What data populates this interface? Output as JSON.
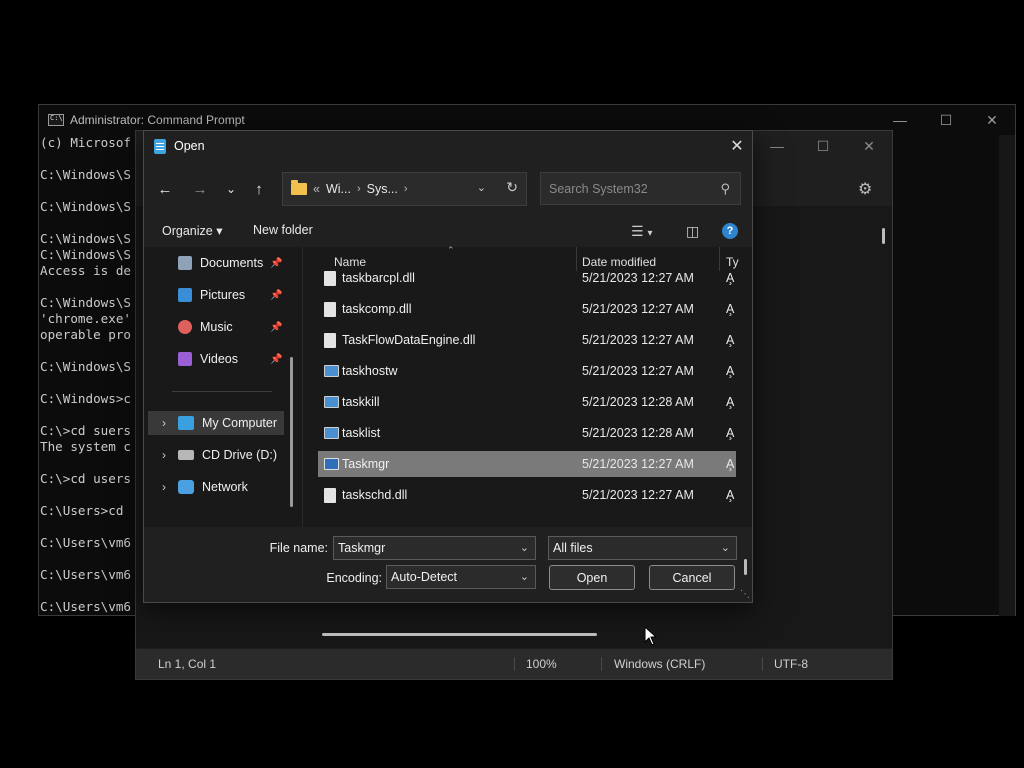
{
  "cmd": {
    "title": "Administrator: Command Prompt",
    "lines": [
      "(c) Microsof",
      "",
      "C:\\Windows\\S",
      "",
      "C:\\Windows\\S",
      "",
      "C:\\Windows\\S",
      "C:\\Windows\\S",
      "Access is de",
      "",
      "C:\\Windows\\S",
      "'chrome.exe'",
      "operable pro",
      "",
      "C:\\Windows\\S",
      "",
      "C:\\Windows>c",
      "",
      "C:\\>cd suers",
      "The system c",
      "",
      "C:\\>cd users",
      "",
      "C:\\Users>cd ",
      "",
      "C:\\Users\\vm6",
      "",
      "C:\\Users\\vm6",
      "",
      "C:\\Users\\vm6"
    ]
  },
  "notepad": {
    "status": {
      "position": "Ln 1, Col 1",
      "zoom": "100%",
      "line_ending": "Windows (CRLF)",
      "encoding": "UTF-8"
    }
  },
  "dialog": {
    "title": "Open",
    "address": {
      "crumbs": [
        "Wi...",
        "Sys..."
      ],
      "overflow": "«"
    },
    "search": {
      "placeholder": "Search System32"
    },
    "toolbar": {
      "organize": "Organize",
      "new_folder": "New folder"
    },
    "nav": {
      "quick": [
        {
          "label": "Documents",
          "icon": "documents-icon",
          "pinned": true
        },
        {
          "label": "Pictures",
          "icon": "pictures-icon",
          "pinned": true
        },
        {
          "label": "Music",
          "icon": "music-icon",
          "pinned": true
        },
        {
          "label": "Videos",
          "icon": "videos-icon",
          "pinned": true
        }
      ],
      "tree": [
        {
          "label": "My Computer",
          "icon": "computer-icon",
          "selected": true
        },
        {
          "label": "CD Drive (D:)",
          "icon": "cd-drive-icon",
          "selected": false
        },
        {
          "label": "Network",
          "icon": "network-icon",
          "selected": false
        }
      ]
    },
    "columns": {
      "name": "Name",
      "date": "Date modified",
      "type": "Ty"
    },
    "files": [
      {
        "name": "taskbarcpl.dll",
        "date": "5/21/2023 12:27 AM",
        "type": "A̧",
        "kind": "dll"
      },
      {
        "name": "taskcomp.dll",
        "date": "5/21/2023 12:27 AM",
        "type": "A̧",
        "kind": "dll"
      },
      {
        "name": "TaskFlowDataEngine.dll",
        "date": "5/21/2023 12:27 AM",
        "type": "A̧",
        "kind": "dll"
      },
      {
        "name": "taskhostw",
        "date": "5/21/2023 12:27 AM",
        "type": "A̧",
        "kind": "exe"
      },
      {
        "name": "taskkill",
        "date": "5/21/2023 12:28 AM",
        "type": "A̧",
        "kind": "exe"
      },
      {
        "name": "tasklist",
        "date": "5/21/2023 12:28 AM",
        "type": "A̧",
        "kind": "exe"
      },
      {
        "name": "Taskmgr",
        "date": "5/21/2023 12:27 AM",
        "type": "A̧",
        "kind": "exe",
        "selected": true
      },
      {
        "name": "taskschd.dll",
        "date": "5/21/2023 12:27 AM",
        "type": "A̧",
        "kind": "dll"
      }
    ],
    "filename": {
      "label": "File name:",
      "value": "Taskmgr"
    },
    "filter": {
      "value": "All files"
    },
    "encoding": {
      "label": "Encoding:",
      "value": "Auto-Detect"
    },
    "buttons": {
      "open": "Open",
      "cancel": "Cancel"
    }
  },
  "colors": {
    "accent": "#2f84d0",
    "selected_row": "#7a7a7a",
    "folder": "#f2c04d"
  }
}
